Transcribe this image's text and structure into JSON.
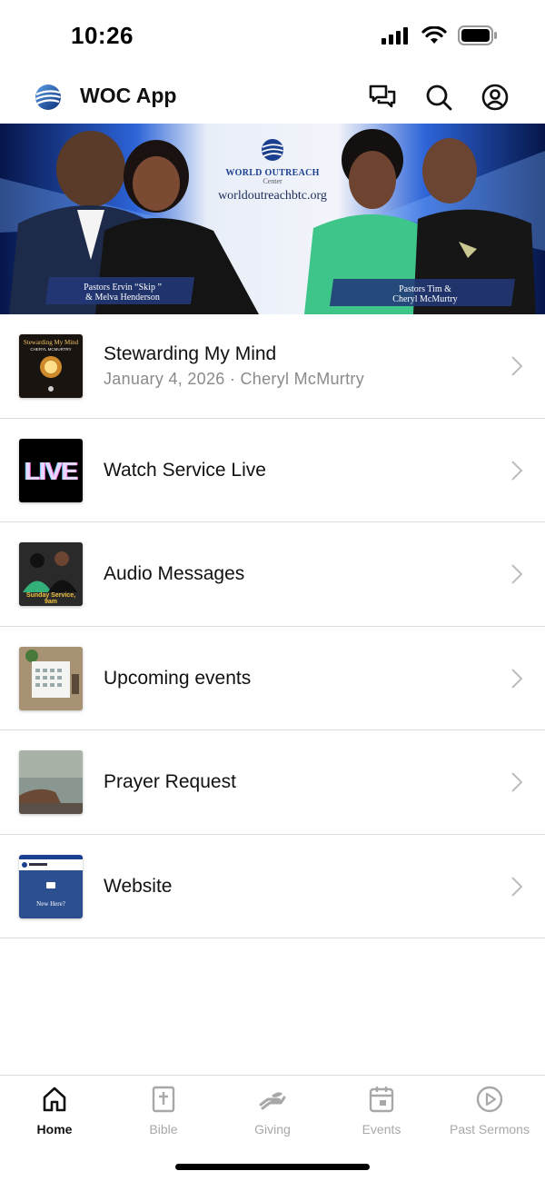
{
  "status_bar": {
    "time": "10:26"
  },
  "header": {
    "title": "WOC App"
  },
  "hero": {
    "brand_name": "WORLD OUTREACH",
    "brand_sub": "Center",
    "url": "worldoutreachbtc.org",
    "caption_left_1": "Pastors Ervin “Skip ”",
    "caption_left_2": "& Melva Henderson",
    "caption_right_1": "Pastors Tim &",
    "caption_right_2": "Cheryl McMurtry"
  },
  "menu": [
    {
      "title": "Stewarding My Mind",
      "subtitle": "January 4, 2026 · Cheryl McMurtry",
      "thumb_title": "Stewarding My Mind",
      "thumb_author": "CHERYL MCMURTRY"
    },
    {
      "title": "Watch Service Live",
      "thumb_text": "LIVE"
    },
    {
      "title": "Audio Messages",
      "thumb_text": "Sunday Service, 9am"
    },
    {
      "title": "Upcoming events"
    },
    {
      "title": "Prayer Request"
    },
    {
      "title": "Website",
      "thumb_text": "New Here?"
    }
  ],
  "tabs": [
    {
      "label": "Home",
      "icon": "home-icon",
      "active": true
    },
    {
      "label": "Bible",
      "icon": "bible-icon",
      "active": false
    },
    {
      "label": "Giving",
      "icon": "giving-icon",
      "active": false
    },
    {
      "label": "Events",
      "icon": "calendar-icon",
      "active": false
    },
    {
      "label": "Past Sermons",
      "icon": "play-circle-icon",
      "active": false
    }
  ],
  "colors": {
    "accent": "#1b3f8f",
    "tab_inactive": "#a8a8a8",
    "divider": "#dcdcdc"
  }
}
